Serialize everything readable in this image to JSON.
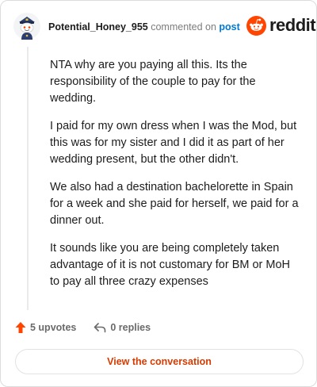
{
  "header": {
    "author": "Potential_Honey_955",
    "commented_on": "commented on",
    "post_link": "post",
    "brand": "reddit"
  },
  "comment": {
    "paragraphs": [
      "NTA why are you paying all this. Its the responsibility of the couple to pay for the wedding.",
      "I paid for my own dress when I was the Mod, but this was for my sister and I did it as part of her wedding present, but the other didn't.",
      "We also had a destination bachelorette in Spain for a week and she paid for herself, we paid for a dinner out.",
      "It sounds like you are being completely taken advantage of it is not customary for BM or MoH to pay all three crazy expenses"
    ]
  },
  "actions": {
    "upvotes": "5 upvotes",
    "replies": "0 replies"
  },
  "view_button": "View the conversation",
  "colors": {
    "brand_orange": "#ff4500",
    "link_blue": "#0079d3",
    "button_text": "#d93a00"
  },
  "icons": [
    "snoo-avatar-icon",
    "reddit-logo-icon",
    "upvote-arrow-icon",
    "reply-arrow-icon"
  ]
}
